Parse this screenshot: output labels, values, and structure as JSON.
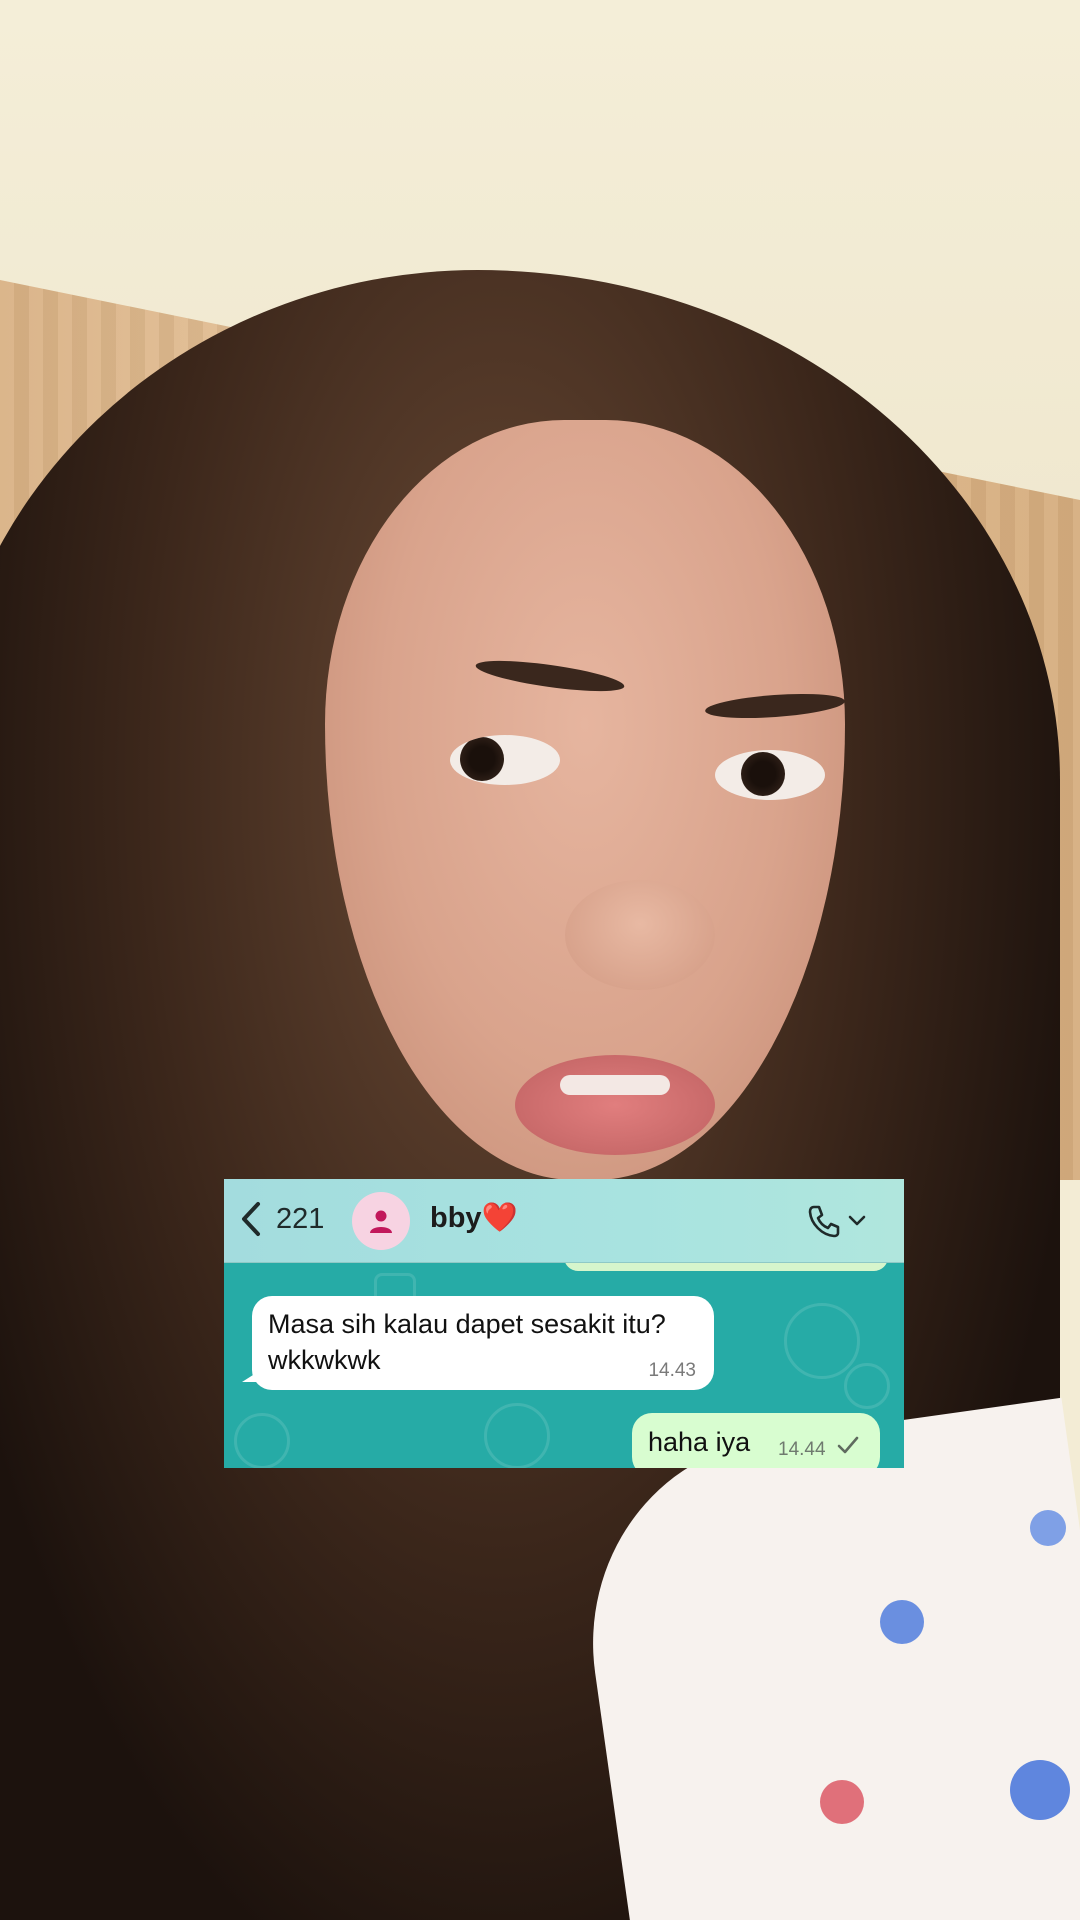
{
  "header": {
    "back_count": "221",
    "contact_name": "bby❤️"
  },
  "messages": [
    {
      "direction": "incoming",
      "text": "Masa sih kalau dapet sesakit itu? wkkwkwk",
      "time": "14.43"
    },
    {
      "direction": "outgoing",
      "text": "haha iya",
      "time": "14.44",
      "status": "sent"
    }
  ],
  "icons": {
    "back": "chevron-left-icon",
    "avatar": "person-icon",
    "call": "phone-icon",
    "call_menu": "chevron-down-icon",
    "status": "check-icon"
  },
  "colors": {
    "header": "#a8e3e0",
    "chat_background": "#26aba6",
    "incoming_bubble": "#ffffff",
    "outgoing_bubble": "#d8fdd0",
    "avatar_background": "#f7d3e2",
    "avatar_icon": "#c2185b"
  }
}
